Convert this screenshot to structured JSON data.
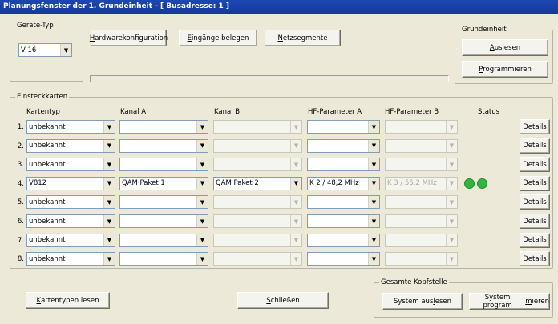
{
  "title": "Planungsfenster der 1. Grundeinheit - [ Busadresse: 1 ]",
  "geraete_typ": {
    "legend": "Geräte-Typ",
    "value": "V 16"
  },
  "top_buttons": {
    "hardware_pre": "",
    "hardware_u": "H",
    "hardware_post": "ardwarekonfiguration",
    "eingaenge_pre": "",
    "eingaenge_u": "E",
    "eingaenge_post": "ingänge belegen",
    "netz_pre": "",
    "netz_u": "N",
    "netz_post": "etzsegmente"
  },
  "grundeinheit": {
    "legend": "Grundeinheit",
    "auslesen_pre": "",
    "auslesen_u": "A",
    "auslesen_post": "uslesen",
    "prog_pre": "",
    "prog_u": "P",
    "prog_post": "rogrammieren"
  },
  "einsteckkarten": {
    "legend": "Einsteckkarten",
    "headers": {
      "kartentyp": "Kartentyp",
      "kanal_a": "Kanal A",
      "kanal_b": "Kanal B",
      "hf_a": "HF-Parameter A",
      "hf_b": "HF-Parameter B",
      "status": "Status"
    },
    "details_label": "Details",
    "rows": [
      {
        "num": "1.",
        "kartentyp": "unbekannt",
        "kanal_a": "",
        "kanal_b": "",
        "hf_a": "",
        "hf_b": ""
      },
      {
        "num": "2.",
        "kartentyp": "unbekannt",
        "kanal_a": "",
        "kanal_b": "",
        "hf_a": "",
        "hf_b": ""
      },
      {
        "num": "3.",
        "kartentyp": "unbekannt",
        "kanal_a": "",
        "kanal_b": "",
        "hf_a": "",
        "hf_b": ""
      },
      {
        "num": "4.",
        "kartentyp": "V812",
        "kanal_a": "QAM Paket 1",
        "kanal_b": "QAM Paket 2",
        "hf_a": "K 2 / 48,2 MHz",
        "hf_b": "K 3 / 55,2 MHz"
      },
      {
        "num": "5.",
        "kartentyp": "unbekannt",
        "kanal_a": "",
        "kanal_b": "",
        "hf_a": "",
        "hf_b": ""
      },
      {
        "num": "6.",
        "kartentyp": "unbekannt",
        "kanal_a": "",
        "kanal_b": "",
        "hf_a": "",
        "hf_b": ""
      },
      {
        "num": "7.",
        "kartentyp": "unbekannt",
        "kanal_a": "",
        "kanal_b": "",
        "hf_a": "",
        "hf_b": ""
      },
      {
        "num": "8.",
        "kartentyp": "unbekannt",
        "kanal_a": "",
        "kanal_b": "",
        "hf_a": "",
        "hf_b": ""
      }
    ]
  },
  "bottom": {
    "kartentypen_pre": "",
    "kartentypen_u": "K",
    "kartentypen_post": "artentypen lesen",
    "schliessen_pre": "",
    "schliessen_u": "S",
    "schliessen_post": "chließen",
    "kopfstelle_legend": "Gesamte Kopfstelle",
    "sys_auslesen_pre": "System aus",
    "sys_auslesen_u": "l",
    "sys_auslesen_post": "esen",
    "sys_prog_pre": "System program",
    "sys_prog_u": "m",
    "sys_prog_post": "ieren"
  },
  "colors": {
    "title_bg": "#1438a0",
    "led_green": "#31b541",
    "window_bg": "#ece9d8"
  }
}
